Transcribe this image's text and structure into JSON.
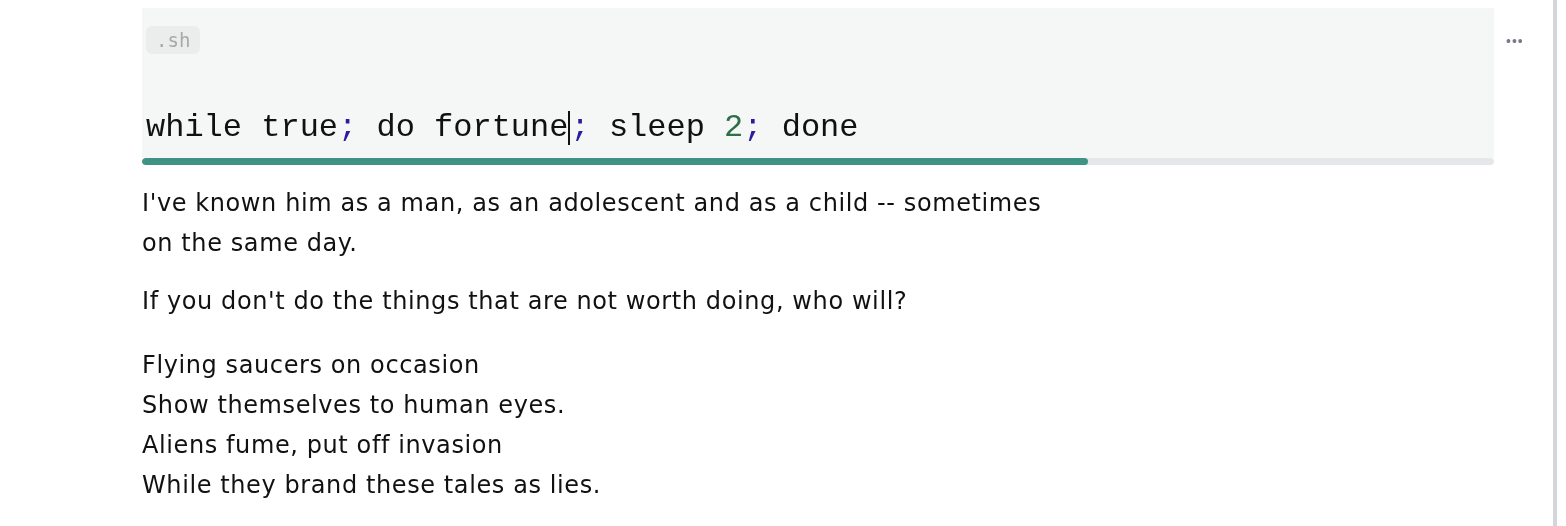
{
  "code_block": {
    "language_badge": ".sh",
    "tokens": [
      {
        "text": "while true",
        "kind": "plain",
        "caret_after": false
      },
      {
        "text": ";",
        "kind": "punct",
        "caret_after": false
      },
      {
        "text": " do fortune",
        "kind": "plain",
        "caret_after": true
      },
      {
        "text": ";",
        "kind": "punct",
        "caret_after": false
      },
      {
        "text": " sleep ",
        "kind": "plain",
        "caret_after": false
      },
      {
        "text": "2",
        "kind": "number",
        "caret_after": false
      },
      {
        "text": ";",
        "kind": "punct",
        "caret_after": false
      },
      {
        "text": " done",
        "kind": "plain",
        "caret_after": false
      }
    ],
    "progress": {
      "level": 0.7
    },
    "more_menu": "•••"
  },
  "paragraphs": [
    {
      "kind": "prose",
      "lines": [
        "I've known him as a man, as an adolescent and as a child -- sometimes on the same day."
      ]
    },
    {
      "kind": "prose",
      "lines": [
        "If you don't do the things that are not worth doing, who will?"
      ]
    },
    {
      "kind": "verse",
      "lines": [
        "Flying saucers on occasion",
        "Show themselves to human eyes.",
        "Aliens fume, put off invasion",
        "While they brand these tales as lies."
      ]
    }
  ]
}
